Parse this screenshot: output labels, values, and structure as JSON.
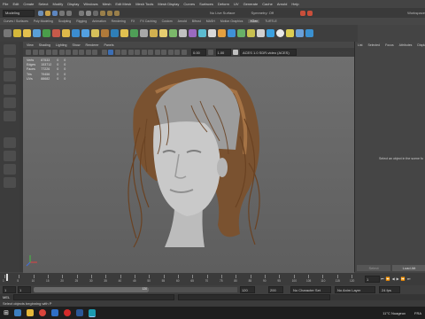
{
  "menu": [
    "File",
    "Edit",
    "Create",
    "Select",
    "Modify",
    "Display",
    "Windows",
    "Mesh",
    "Edit Mesh",
    "Mesh Tools",
    "Mesh Display",
    "Curves",
    "Surfaces",
    "Deform",
    "UV",
    "Generate",
    "Cache",
    "Arnold",
    "Help"
  ],
  "status": {
    "workspace_label": "Modeling",
    "no_live_surface": "No Live Surface",
    "symmetry": "Symmetry: Off",
    "right_label": "Workspace"
  },
  "shelf_tabs": [
    "Curves / Surfaces",
    "Poly Modeling",
    "Sculpting",
    "Rigging",
    "Animation",
    "Rendering",
    "FX",
    "FX Caching",
    "Custom",
    "Arnold",
    "Bifrost",
    "MASH",
    "Motion Graphics",
    "XGen",
    "TURTLE"
  ],
  "shelf_active": "XGen",
  "viewport": {
    "menu": [
      "View",
      "Shading",
      "Lighting",
      "Show",
      "Renderer",
      "Panels"
    ],
    "toolbar_value1": "0.00",
    "toolbar_value2": "1.00",
    "colorspace": "ACES 1.0 SDR-video (ACES)",
    "hud": [
      {
        "label": "Verts",
        "v1": "87533",
        "v2": "0",
        "v3": "0"
      },
      {
        "label": "Edges",
        "v1": "153712",
        "v2": "0",
        "v3": "0"
      },
      {
        "label": "Faces",
        "v1": "77226",
        "v2": "0",
        "v3": "0"
      },
      {
        "label": "Tris",
        "v1": "79456",
        "v2": "0",
        "v3": "0"
      },
      {
        "label": "UVs",
        "v1": "88682",
        "v2": "0",
        "v3": "0"
      }
    ]
  },
  "attribute_editor": {
    "tabs": [
      "List",
      "Selected",
      "Focus",
      "Attributes",
      "Display"
    ],
    "empty_message": "Select an object in the scene fo",
    "select_button": "Select",
    "load_button": "Load Att"
  },
  "timeline": {
    "ticks": [
      "1",
      "5",
      "10",
      "15",
      "20",
      "25",
      "30",
      "35",
      "40",
      "45",
      "50",
      "55",
      "60",
      "65",
      "70",
      "75",
      "80",
      "85",
      "90",
      "95",
      "100",
      "105",
      "110",
      "115",
      "120"
    ],
    "current_frame": "1"
  },
  "range": {
    "start": "1",
    "inner_start": "1",
    "inner_end": "120",
    "end": "120",
    "playback_end": "200",
    "character_set": "No Character Set",
    "anim_layer": "No Anim Layer",
    "fps": "24 fps"
  },
  "command_line": {
    "lang": "MEL"
  },
  "help_line": "Select objects beginning with P",
  "taskbar": {
    "weather": "11°C  Nuageux",
    "lang": "FRA"
  }
}
